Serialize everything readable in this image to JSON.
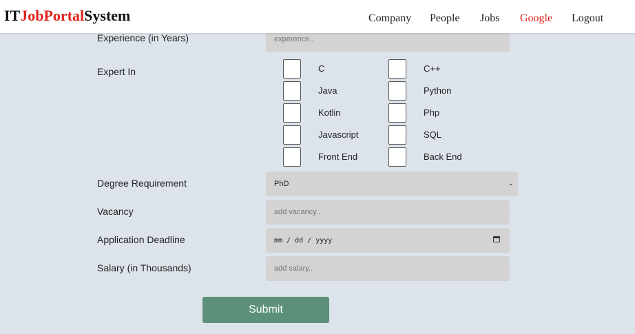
{
  "navbar": {
    "brand": {
      "prefix": "IT",
      "middle": "JobPortal",
      "suffix": "System"
    },
    "links": [
      "Company",
      "People",
      "Jobs",
      "Google",
      "Logout"
    ],
    "active_link": "Google",
    "accent_color": "#e0231b"
  },
  "form": {
    "experience": {
      "label": "Experience (in Years)",
      "placeholder": "experence.."
    },
    "expert_in": {
      "label": "Expert In",
      "options": [
        {
          "label": "C",
          "checked": false
        },
        {
          "label": "C++",
          "checked": false
        },
        {
          "label": "Java",
          "checked": false
        },
        {
          "label": "Python",
          "checked": false
        },
        {
          "label": "Kotlin",
          "checked": false
        },
        {
          "label": "Php",
          "checked": false
        },
        {
          "label": "Javascript",
          "checked": false
        },
        {
          "label": "SQL",
          "checked": false
        },
        {
          "label": "Front End",
          "checked": false
        },
        {
          "label": "Back End",
          "checked": false
        }
      ]
    },
    "degree": {
      "label": "Degree Requirement",
      "selected": "PhD"
    },
    "vacancy": {
      "label": "Vacancy",
      "placeholder": "add vacancy.."
    },
    "deadline": {
      "label": "Application Deadline",
      "placeholder": "mm / dd / yyyy"
    },
    "salary": {
      "label": "Salary (in Thousands)",
      "placeholder": "add salary.."
    },
    "submit_label": "Submit",
    "submit_color": "#5c907a"
  }
}
